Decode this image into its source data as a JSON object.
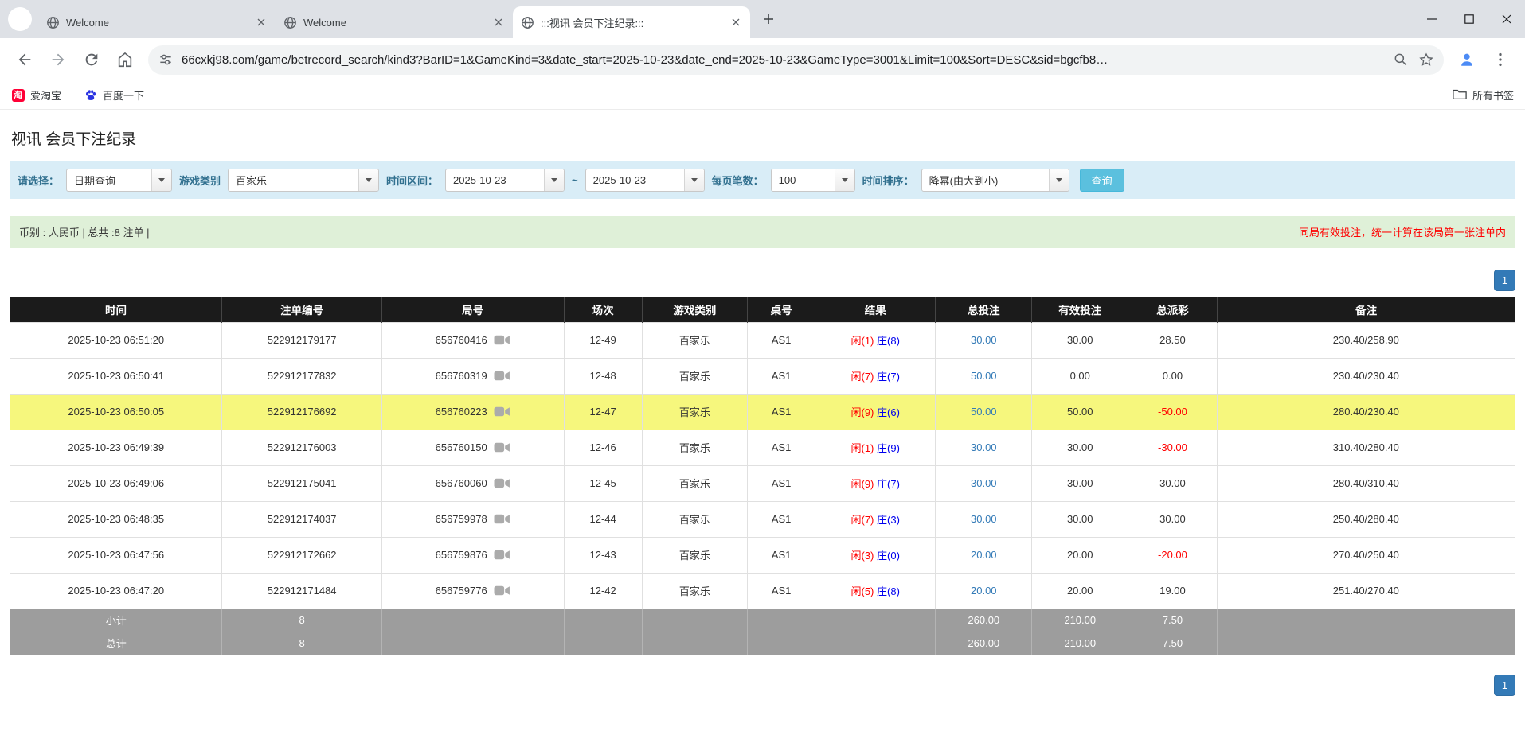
{
  "theme": {
    "accent": "#337ab7",
    "header_bg": "#1b1b1b",
    "footer_bg": "#9d9d9d",
    "highlight": "#f6f77d",
    "filter_bg": "#d9edf7",
    "summary_bg": "#dff0d8",
    "query_btn": "#5bc0de",
    "player_red": "#ff0000",
    "banker_blue": "#0000ee"
  },
  "browser": {
    "tabs": [
      {
        "title": "Welcome"
      },
      {
        "title": "Welcome"
      },
      {
        "title": ":::视讯 会员下注纪录:::"
      }
    ],
    "url": "66cxkj98.com/game/betrecord_search/kind3?BarID=1&GameKind=3&date_start=2025-10-23&date_end=2025-10-23&GameType=3001&Limit=100&Sort=DESC&sid=bgcfb8…",
    "bookmarks": [
      {
        "label": "爱淘宝",
        "badge": "淘"
      },
      {
        "label": "百度一下"
      }
    ],
    "all_bookmarks_label": "所有书签"
  },
  "page": {
    "title": "视讯 会员下注纪录",
    "filters": {
      "query_type_label": "请选择：",
      "query_type_value": "日期查询",
      "game_category_label": "游戏类别",
      "game_category_value": "百家乐",
      "date_range_label": "时间区间：",
      "date_start": "2025-10-23",
      "date_separator": "~",
      "date_end": "2025-10-23",
      "page_size_label": "每页笔数：",
      "page_size_value": "100",
      "sort_label": "时间排序：",
      "sort_value": "降幂(由大到小)",
      "search_button_label": "查询"
    },
    "summary": {
      "currency_info": "币别 : 人民币 | 总共 :8 注单 |",
      "notice": "同局有效投注，统一计算在该局第一张注单内"
    },
    "pagination": {
      "current_page": "1"
    },
    "table": {
      "headers": [
        "时间",
        "注单编号",
        "局号",
        "场次",
        "游戏类别",
        "桌号",
        "结果",
        "总投注",
        "有效投注",
        "总派彩",
        "备注"
      ],
      "rows": [
        {
          "time": "2025-10-23 06:51:20",
          "bet_id": "522912179177",
          "round": "656760416",
          "session": "12-49",
          "game_type": "百家乐",
          "table_no": "AS1",
          "result_player": "闲(1)",
          "result_banker": "庄(8)",
          "total_bet": "30.00",
          "valid_bet": "30.00",
          "payout": "28.50",
          "note": "230.40/258.90",
          "highlight": false
        },
        {
          "time": "2025-10-23 06:50:41",
          "bet_id": "522912177832",
          "round": "656760319",
          "session": "12-48",
          "game_type": "百家乐",
          "table_no": "AS1",
          "result_player": "闲(7)",
          "result_banker": "庄(7)",
          "total_bet": "50.00",
          "valid_bet": "0.00",
          "payout": "0.00",
          "note": "230.40/230.40",
          "highlight": false
        },
        {
          "time": "2025-10-23 06:50:05",
          "bet_id": "522912176692",
          "round": "656760223",
          "session": "12-47",
          "game_type": "百家乐",
          "table_no": "AS1",
          "result_player": "闲(9)",
          "result_banker": "庄(6)",
          "total_bet": "50.00",
          "valid_bet": "50.00",
          "payout": "-50.00",
          "note": "280.40/230.40",
          "highlight": true
        },
        {
          "time": "2025-10-23 06:49:39",
          "bet_id": "522912176003",
          "round": "656760150",
          "session": "12-46",
          "game_type": "百家乐",
          "table_no": "AS1",
          "result_player": "闲(1)",
          "result_banker": "庄(9)",
          "total_bet": "30.00",
          "valid_bet": "30.00",
          "payout": "-30.00",
          "note": "310.40/280.40",
          "highlight": false
        },
        {
          "time": "2025-10-23 06:49:06",
          "bet_id": "522912175041",
          "round": "656760060",
          "session": "12-45",
          "game_type": "百家乐",
          "table_no": "AS1",
          "result_player": "闲(9)",
          "result_banker": "庄(7)",
          "total_bet": "30.00",
          "valid_bet": "30.00",
          "payout": "30.00",
          "note": "280.40/310.40",
          "highlight": false
        },
        {
          "time": "2025-10-23 06:48:35",
          "bet_id": "522912174037",
          "round": "656759978",
          "session": "12-44",
          "game_type": "百家乐",
          "table_no": "AS1",
          "result_player": "闲(7)",
          "result_banker": "庄(3)",
          "total_bet": "30.00",
          "valid_bet": "30.00",
          "payout": "30.00",
          "note": "250.40/280.40",
          "highlight": false
        },
        {
          "time": "2025-10-23 06:47:56",
          "bet_id": "522912172662",
          "round": "656759876",
          "session": "12-43",
          "game_type": "百家乐",
          "table_no": "AS1",
          "result_player": "闲(3)",
          "result_banker": "庄(0)",
          "total_bet": "20.00",
          "valid_bet": "20.00",
          "payout": "-20.00",
          "note": "270.40/250.40",
          "highlight": false
        },
        {
          "time": "2025-10-23 06:47:20",
          "bet_id": "522912171484",
          "round": "656759776",
          "session": "12-42",
          "game_type": "百家乐",
          "table_no": "AS1",
          "result_player": "闲(5)",
          "result_banker": "庄(8)",
          "total_bet": "20.00",
          "valid_bet": "20.00",
          "payout": "19.00",
          "note": "251.40/270.40",
          "highlight": false
        }
      ],
      "subtotal": {
        "label": "小计",
        "count": "8",
        "total_bet": "260.00",
        "valid_bet": "210.00",
        "payout": "7.50"
      },
      "total": {
        "label": "总计",
        "count": "8",
        "total_bet": "260.00",
        "valid_bet": "210.00",
        "payout": "7.50"
      }
    }
  }
}
